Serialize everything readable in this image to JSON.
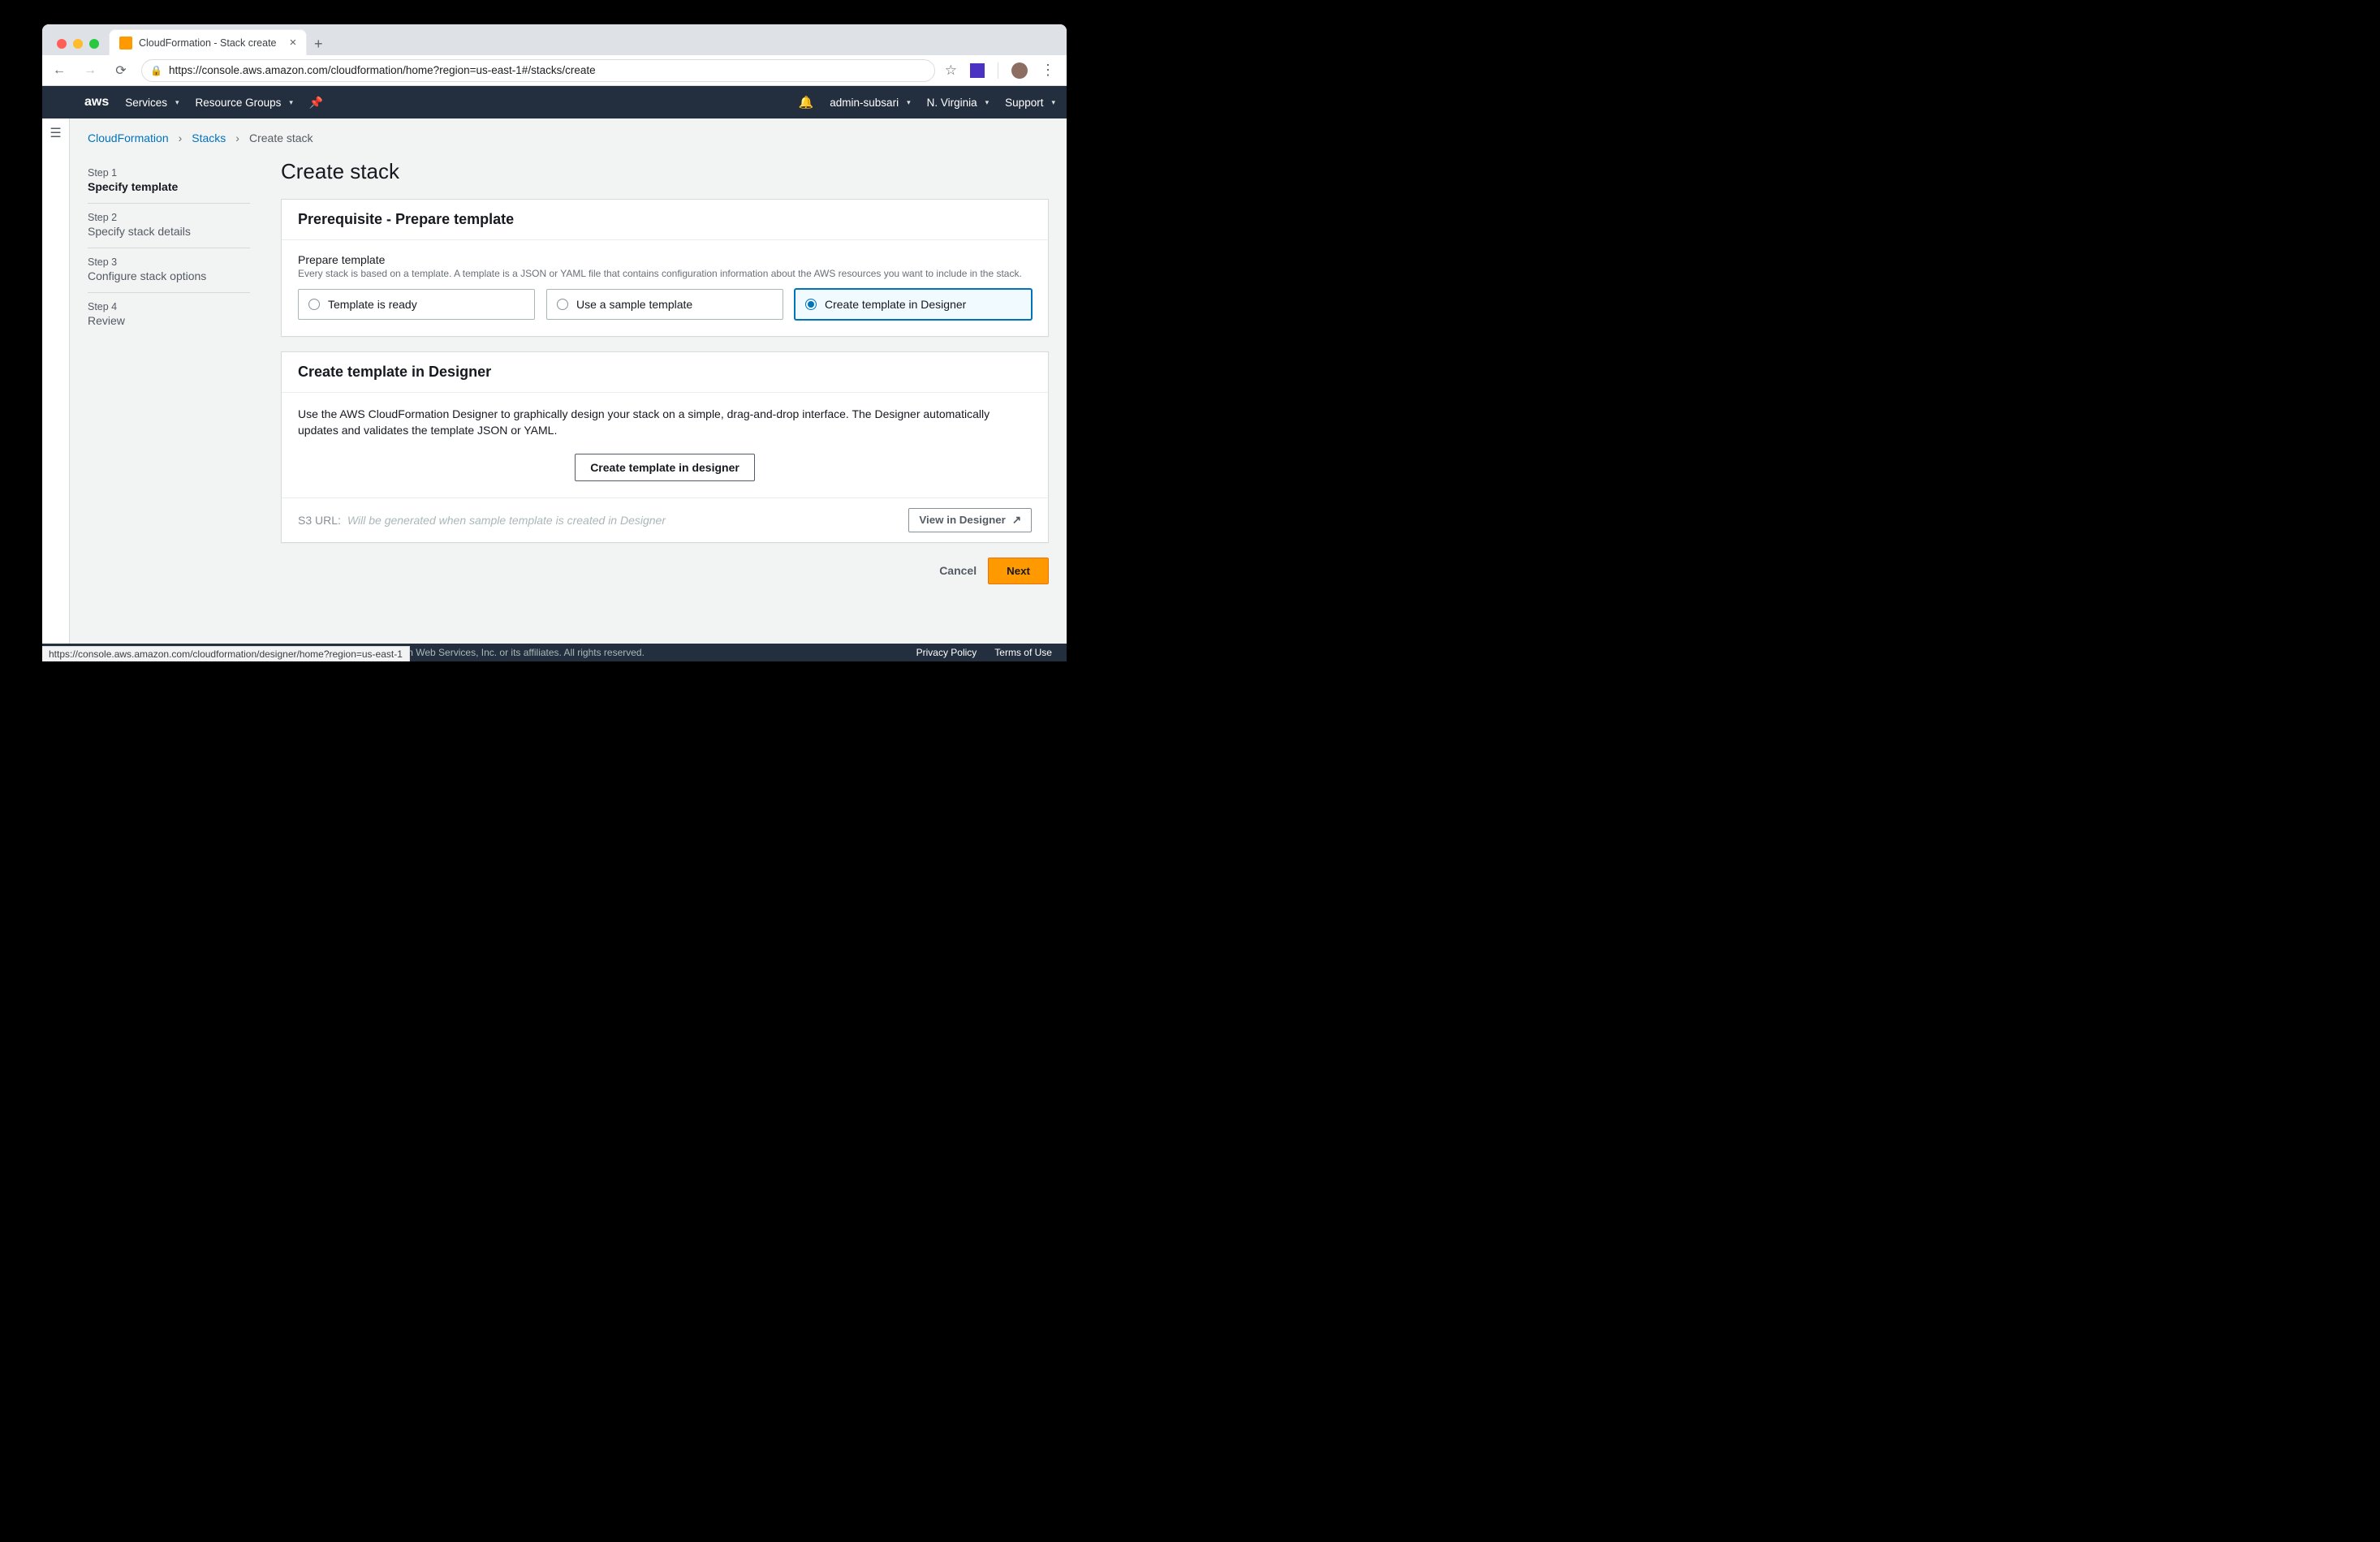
{
  "browser": {
    "tab_title": "CloudFormation - Stack create",
    "url": "https://console.aws.amazon.com/cloudformation/home?region=us-east-1#/stacks/create",
    "status_url": "https://console.aws.amazon.com/cloudformation/designer/home?region=us-east-1"
  },
  "nav": {
    "logo": "aws",
    "services": "Services",
    "resource_groups": "Resource Groups",
    "user": "admin-subsari",
    "region": "N. Virginia",
    "support": "Support"
  },
  "crumbs": [
    "CloudFormation",
    "Stacks",
    "Create stack"
  ],
  "wizard_steps": [
    {
      "num": "Step 1",
      "label": "Specify template",
      "active": true
    },
    {
      "num": "Step 2",
      "label": "Specify stack details",
      "active": false
    },
    {
      "num": "Step 3",
      "label": "Configure stack options",
      "active": false
    },
    {
      "num": "Step 4",
      "label": "Review",
      "active": false
    }
  ],
  "page_title": "Create stack",
  "prereq": {
    "heading": "Prerequisite - Prepare template",
    "field_label": "Prepare template",
    "help": "Every stack is based on a template. A template is a JSON or YAML file that contains configuration information about the AWS resources you want to include in the stack.",
    "options": [
      "Template is ready",
      "Use a sample template",
      "Create template in Designer"
    ],
    "selected_index": 2
  },
  "designer": {
    "heading": "Create template in Designer",
    "desc": "Use the AWS CloudFormation Designer to graphically design your stack on a simple, drag-and-drop interface. The Designer automatically updates and validates the template JSON or YAML.",
    "button": "Create template in designer",
    "s3_label": "S3 URL:",
    "s3_value": "Will be generated when sample template is created in Designer",
    "view_btn": "View in Designer"
  },
  "actions": {
    "cancel": "Cancel",
    "next": "Next"
  },
  "footer": {
    "copy": "© 2008 - 2019, Amazon Web Services, Inc. or its affiliates. All rights reserved.",
    "privacy": "Privacy Policy",
    "terms": "Terms of Use"
  }
}
